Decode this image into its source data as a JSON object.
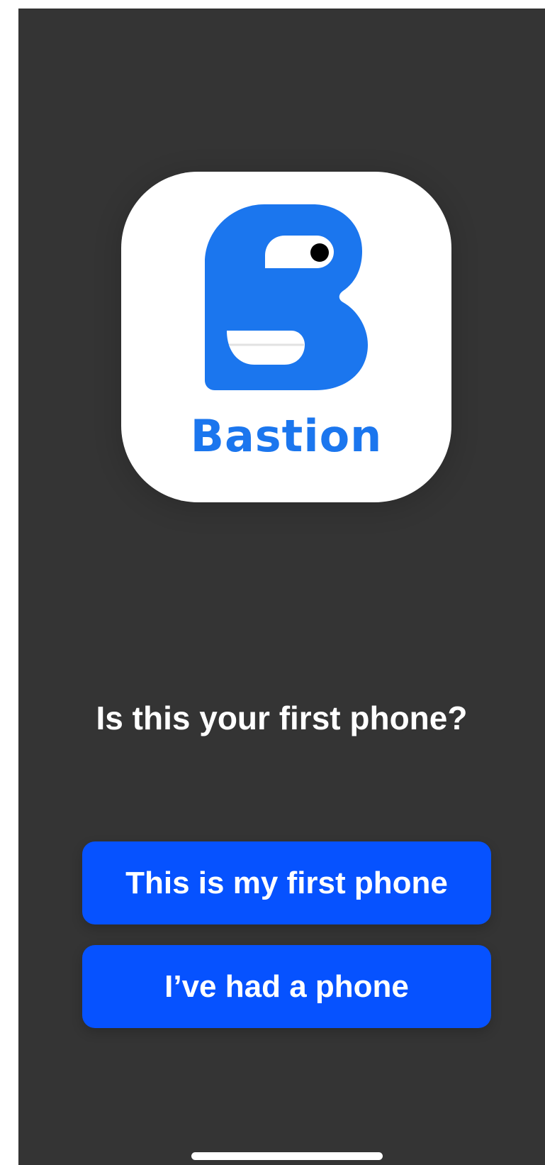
{
  "app": {
    "brand_name": "Bastion",
    "logo_icon": "bastion-mascot-icon",
    "brand_color": "#1b76ee"
  },
  "onboarding": {
    "question": "Is this your first phone?",
    "options": [
      {
        "label": "This is my first phone"
      },
      {
        "label": "I’ve had a phone"
      }
    ]
  },
  "theme": {
    "background": "#343434",
    "button_color": "#0652ff",
    "text_color": "#ffffff"
  }
}
